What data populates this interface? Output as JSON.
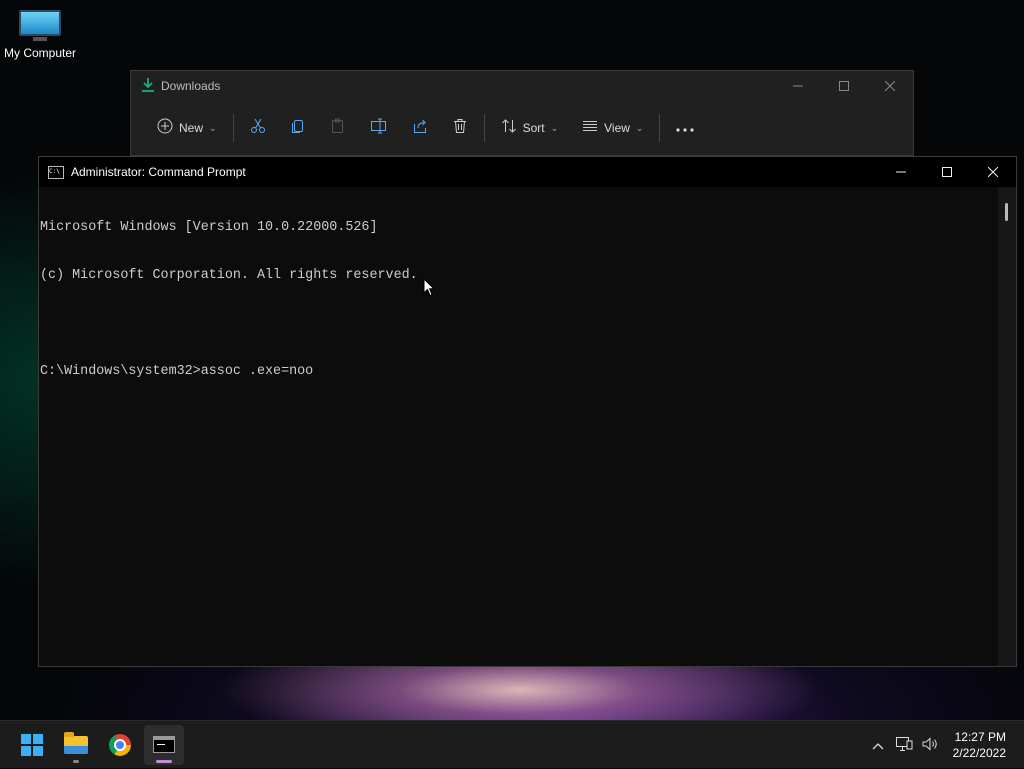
{
  "desktop": {
    "icons": [
      {
        "label": "My Computer",
        "icon": "monitor-icon"
      }
    ]
  },
  "explorer": {
    "title": "Downloads",
    "toolbar": {
      "new_label": "New",
      "sort_label": "Sort",
      "view_label": "View",
      "icons": [
        "plus-circle-icon",
        "cut-icon",
        "copy-icon",
        "paste-icon",
        "rename-icon",
        "share-icon",
        "delete-icon",
        "sort-icon",
        "view-icon",
        "more-icon"
      ]
    },
    "window_buttons": [
      "minimize",
      "maximize",
      "close"
    ]
  },
  "cmd": {
    "title": "Administrator: Command Prompt",
    "icon_text": "C:\\",
    "lines": [
      "Microsoft Windows [Version 10.0.22000.526]",
      "(c) Microsoft Corporation. All rights reserved.",
      "",
      "C:\\Windows\\system32>assoc .exe=noo"
    ]
  },
  "taskbar": {
    "apps": [
      "windows-start",
      "file-explorer",
      "chrome",
      "command-prompt"
    ],
    "active_app": "command-prompt",
    "clock": {
      "time": "12:27 PM",
      "date": "2/22/2022"
    },
    "tray_icons": [
      "chevron-up-icon",
      "network-icon",
      "volume-icon"
    ]
  }
}
